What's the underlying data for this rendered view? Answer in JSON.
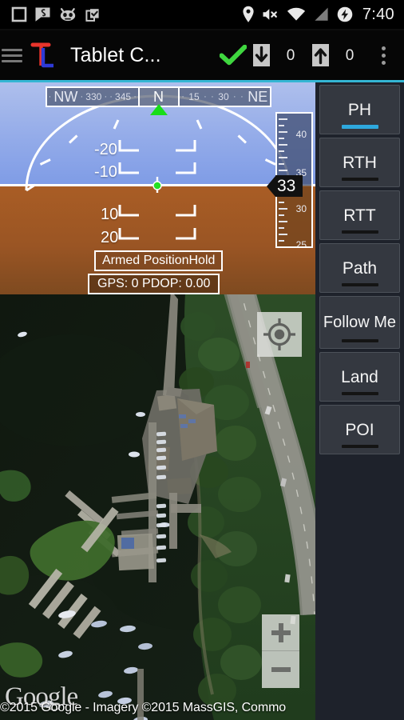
{
  "statusbar": {
    "time": "7:40",
    "left_icons": [
      "square-icon",
      "voice-chat-icon",
      "cyanogenmod-icon",
      "clipboard-check-icon"
    ],
    "right_icons": [
      "location-pin-icon",
      "volume-muted-icon",
      "wifi-icon",
      "signal-bars-icon",
      "battery-charging-icon"
    ]
  },
  "appbar": {
    "menu_icon": "hamburger-icon",
    "logo_icon": "tower-logo-icon",
    "title": "Tablet C...",
    "link_ok_icon": "green-check-icon",
    "download_icon": "download-arrow-icon",
    "download_count": "0",
    "upload_icon": "upload-arrow-icon",
    "upload_count": "0",
    "overflow_icon": "overflow-menu-icon",
    "accent_color": "#34b6d4"
  },
  "hud": {
    "compass": {
      "left_labels": [
        "NW",
        "330",
        "345"
      ],
      "center_label": "N",
      "right_labels": [
        "15",
        "30",
        "NE"
      ],
      "heading_marker": "heading-triangle-icon"
    },
    "pitch_ladder": [
      "-20",
      "-10",
      "10",
      "20"
    ],
    "center_marker": "aircraft-center-dot",
    "altitude_tape": {
      "ticks": [
        "40",
        "35",
        "30",
        "25"
      ],
      "current": "33"
    },
    "status_text": "Armed PositionHold",
    "gps_text": "GPS: 0   PDOP: 0.00",
    "sky_color": "#93abe9",
    "ground_color": "#9a5524"
  },
  "sidepanel": {
    "buttons": [
      {
        "label": "PH",
        "active": true
      },
      {
        "label": "RTH",
        "active": false
      },
      {
        "label": "RTT",
        "active": false
      },
      {
        "label": "Path",
        "active": false
      },
      {
        "label": "Follow Me",
        "active": false
      },
      {
        "label": "Land",
        "active": false
      },
      {
        "label": "POI",
        "active": false
      }
    ],
    "active_color": "#2ea8dd"
  },
  "map": {
    "my_location_icon": "crosshair-location-icon",
    "zoom_in_icon": "plus-icon",
    "zoom_out_icon": "minus-icon",
    "logo_text": "Google",
    "attribution": "©2015 Google - Imagery ©2015 MassGIS, Commo"
  }
}
